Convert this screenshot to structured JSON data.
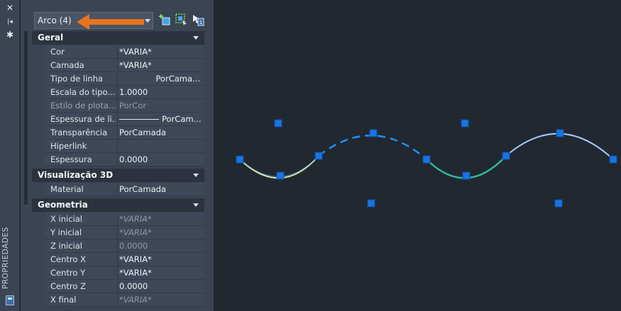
{
  "strip": {
    "label": "PROPRIEDADES",
    "close": "✕",
    "pin": "⏵",
    "settings": "✱"
  },
  "selector": {
    "value": "Arco (4)"
  },
  "toolbar": {
    "icons": [
      "add-to-selection-icon",
      "quick-select-icon",
      "toggle-pickadd-icon"
    ]
  },
  "sections": [
    {
      "title": "Geral",
      "rows": [
        {
          "key": "Cor",
          "value": "*VARIA*"
        },
        {
          "key": "Camada",
          "value": "*VARIA*"
        },
        {
          "key": "Tipo de linha",
          "value": "PorCama..."
        },
        {
          "key": "Escala do tipo...",
          "value": "1.0000"
        },
        {
          "key": "Estilo de plota...",
          "value": "PorCor"
        },
        {
          "key": "Espessura de li...",
          "value": "PorCam..."
        },
        {
          "key": "Transparência",
          "value": "PorCamada"
        },
        {
          "key": "Hiperlink",
          "value": ""
        },
        {
          "key": "Espessura",
          "value": "0.0000"
        }
      ]
    },
    {
      "title": "Visualização 3D",
      "rows": [
        {
          "key": "Material",
          "value": "PorCamada"
        }
      ]
    },
    {
      "title": "Geometria",
      "rows": [
        {
          "key": "X inicial",
          "value": "*VARIA*"
        },
        {
          "key": "Y inicial",
          "value": "*VARIA*"
        },
        {
          "key": "Z inicial",
          "value": "0.0000"
        },
        {
          "key": "Centro X",
          "value": "*VARIA*"
        },
        {
          "key": "Centro Y",
          "value": "*VARIA*"
        },
        {
          "key": "Centro Z",
          "value": "0.0000"
        },
        {
          "key": "X final",
          "value": "*VARIA*"
        }
      ]
    }
  ],
  "colors": {
    "background": "#212830",
    "panel": "#3b4453",
    "grip": "#1a73e0",
    "arrow": "#e8731f",
    "arc_highlight": "#66b8ff",
    "arc_dashed": "#1e90ff",
    "arc_green": "#2fb6a0"
  }
}
